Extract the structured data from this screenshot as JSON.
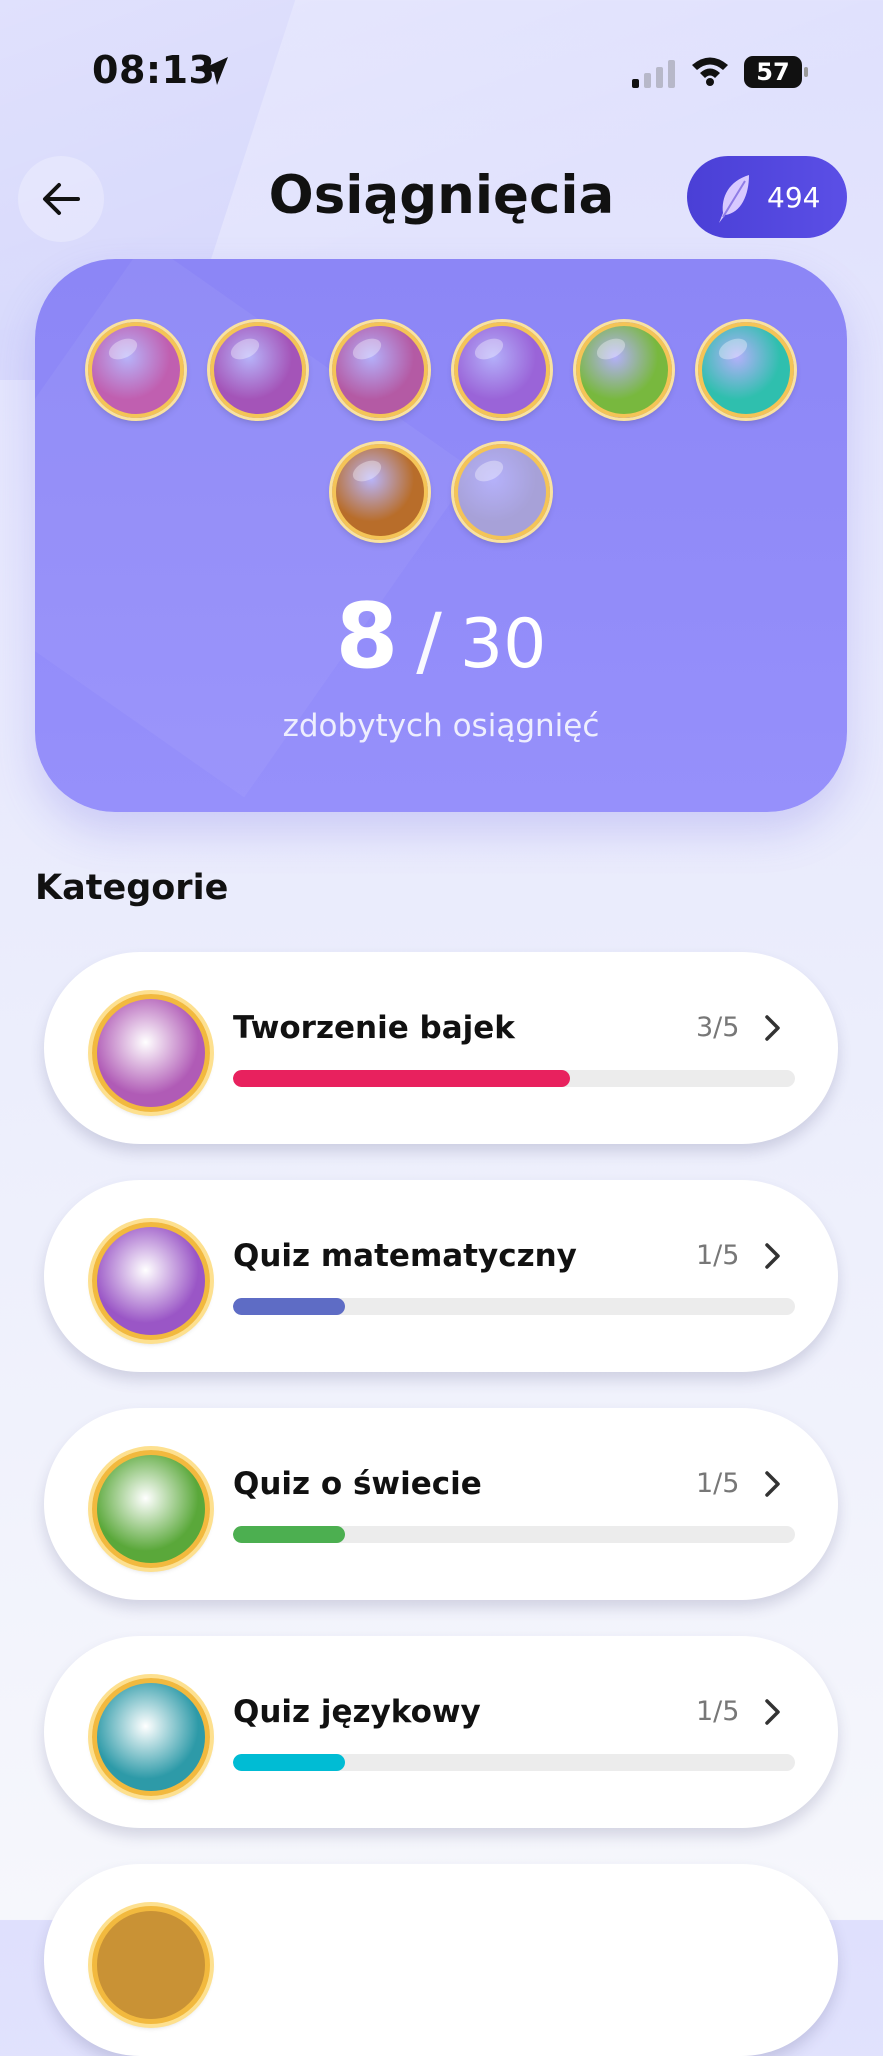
{
  "status_bar": {
    "time": "08:13",
    "battery": "57"
  },
  "header": {
    "title": "Osiągnięcia",
    "feathers": "494"
  },
  "summary": {
    "badges": [
      {
        "name": "badge-open-book",
        "color": "#c05fb0"
      },
      {
        "name": "badge-book-feathers",
        "color": "#a454b8"
      },
      {
        "name": "badge-book-castle",
        "color": "#b45aa4"
      },
      {
        "name": "badge-magic-numbers",
        "color": "#9a64d8"
      },
      {
        "name": "badge-world-map",
        "color": "#78b83e"
      },
      {
        "name": "badge-language-bubbles",
        "color": "#2fbfae"
      },
      {
        "name": "badge-candle",
        "color": "#b86d2a"
      },
      {
        "name": "badge-night-book",
        "color": "#a7a1d8"
      }
    ],
    "earned": "8",
    "separator": "/",
    "total": "30",
    "caption": "zdobytych osiągnięć"
  },
  "categories_title": "Kategorie",
  "categories": [
    {
      "name": "Tworzenie bajek",
      "progress": "3/5",
      "fraction": 0.6,
      "bar_color": "#e8215e",
      "icon_color": "#b05bb6"
    },
    {
      "name": "Quiz matematyczny",
      "progress": "1/5",
      "fraction": 0.2,
      "bar_color": "#5e6cc5",
      "icon_color": "#9a56c6"
    },
    {
      "name": "Quiz o świecie",
      "progress": "1/5",
      "fraction": 0.2,
      "bar_color": "#4caf50",
      "icon_color": "#5aa83a"
    },
    {
      "name": "Quiz językowy",
      "progress": "1/5",
      "fraction": 0.2,
      "bar_color": "#00bcd4",
      "icon_color": "#2d9aa8"
    }
  ]
}
